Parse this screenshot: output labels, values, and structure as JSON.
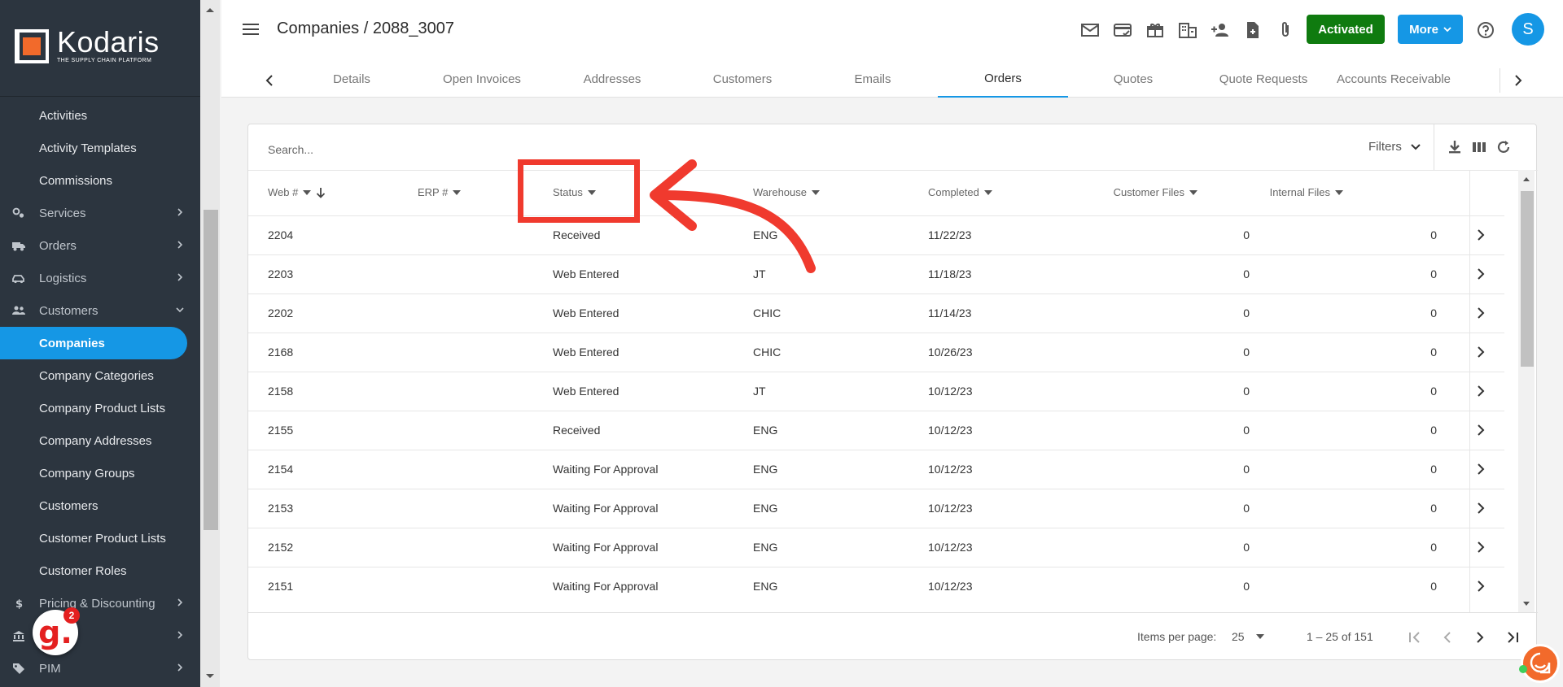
{
  "logo": {
    "name": "Kodaris",
    "tagline": "THE SUPPLY CHAIN PLATFORM"
  },
  "sidebar": {
    "items": [
      {
        "label": "Activities",
        "kind": "sub"
      },
      {
        "label": "Activity Templates",
        "kind": "sub"
      },
      {
        "label": "Commissions",
        "kind": "sub"
      },
      {
        "label": "Services",
        "kind": "top",
        "icon": "gears-icon"
      },
      {
        "label": "Orders",
        "kind": "top",
        "icon": "truck-icon"
      },
      {
        "label": "Logistics",
        "kind": "top",
        "icon": "car-icon"
      },
      {
        "label": "Customers",
        "kind": "top",
        "icon": "people-icon"
      },
      {
        "label": "Companies",
        "kind": "active"
      },
      {
        "label": "Company Categories",
        "kind": "sub"
      },
      {
        "label": "Company Product Lists",
        "kind": "sub"
      },
      {
        "label": "Company Addresses",
        "kind": "sub"
      },
      {
        "label": "Company Groups",
        "kind": "sub"
      },
      {
        "label": "Customers",
        "kind": "sub"
      },
      {
        "label": "Customer Product Lists",
        "kind": "sub"
      },
      {
        "label": "Customer Roles",
        "kind": "sub"
      },
      {
        "label": "Pricing & Discounting",
        "kind": "top",
        "icon": "dollar-icon"
      },
      {
        "label": "",
        "kind": "top",
        "icon": "bank-icon"
      },
      {
        "label": "PIM",
        "kind": "top",
        "icon": "tag-icon"
      }
    ]
  },
  "helper_badge": {
    "letter": "g.",
    "count": "2"
  },
  "header": {
    "title": "Companies / 2088_3007",
    "activated_label": "Activated",
    "more_label": "More",
    "avatar_letter": "S",
    "accent": "#1597e5",
    "activated_color": "#0f7b0f"
  },
  "tabs": [
    "Details",
    "Open Invoices",
    "Addresses",
    "Customers",
    "Emails",
    "Orders",
    "Quotes",
    "Quote Requests",
    "Accounts Receivable"
  ],
  "active_tab": "Orders",
  "toolbar": {
    "search_placeholder": "Search...",
    "filters_label": "Filters"
  },
  "table": {
    "columns": [
      "Web #",
      "ERP #",
      "Status",
      "Warehouse",
      "Completed",
      "Customer Files",
      "Internal Files"
    ],
    "rows": [
      [
        "2204",
        "",
        "Received",
        "ENG",
        "11/22/23",
        "0",
        "0"
      ],
      [
        "2203",
        "",
        "Web Entered",
        "JT",
        "11/18/23",
        "0",
        "0"
      ],
      [
        "2202",
        "",
        "Web Entered",
        "CHIC",
        "11/14/23",
        "0",
        "0"
      ],
      [
        "2168",
        "",
        "Web Entered",
        "CHIC",
        "10/26/23",
        "0",
        "0"
      ],
      [
        "2158",
        "",
        "Web Entered",
        "JT",
        "10/12/23",
        "0",
        "0"
      ],
      [
        "2155",
        "",
        "Received",
        "ENG",
        "10/12/23",
        "0",
        "0"
      ],
      [
        "2154",
        "",
        "Waiting For Approval",
        "ENG",
        "10/12/23",
        "0",
        "0"
      ],
      [
        "2153",
        "",
        "Waiting For Approval",
        "ENG",
        "10/12/23",
        "0",
        "0"
      ],
      [
        "2152",
        "",
        "Waiting For Approval",
        "ENG",
        "10/12/23",
        "0",
        "0"
      ],
      [
        "2151",
        "",
        "Waiting For Approval",
        "ENG",
        "10/12/23",
        "0",
        "0"
      ]
    ]
  },
  "pagination": {
    "items_per_page_label": "Items per page:",
    "items_per_page": "25",
    "range": "1 – 25 of 151"
  },
  "annotation_color": "#f03a2e"
}
